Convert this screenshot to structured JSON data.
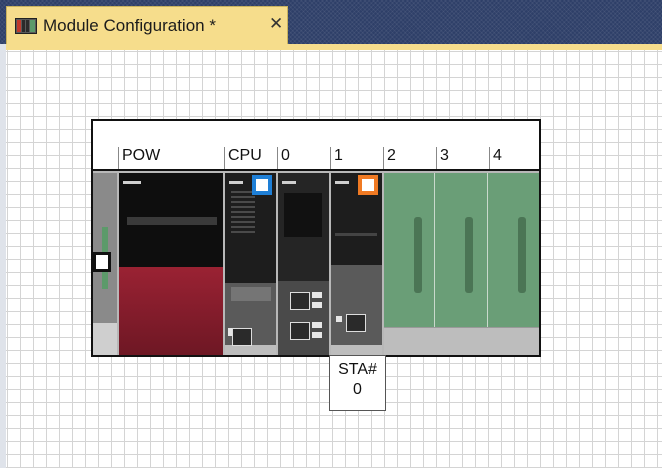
{
  "tab": {
    "title": "Module Configuration *",
    "close_glyph": "✕",
    "icon": "module-configuration-icon"
  },
  "rack": {
    "slot_labels": [
      "POW",
      "CPU",
      "0",
      "1",
      "2",
      "3",
      "4"
    ],
    "modules": [
      {
        "slot": "POW",
        "icon": "power-supply-module"
      },
      {
        "slot": "CPU",
        "icon": "cpu-module",
        "indicator_color": "#1e7fd6"
      },
      {
        "slot": "0",
        "icon": "network-module"
      },
      {
        "slot": "1",
        "icon": "io-module",
        "indicator_color": "#f07a23"
      },
      {
        "slot": "2",
        "icon": "empty-slot"
      },
      {
        "slot": "3",
        "icon": "empty-slot"
      },
      {
        "slot": "4",
        "icon": "empty-slot"
      }
    ]
  },
  "station": {
    "label": "STA#",
    "number": "0"
  },
  "colors": {
    "tab_bg": "#f6dd8c",
    "tabstrip_bg": "#2e3f68",
    "power_module": "#8c1f2e",
    "empty_slot": "#6a9e77",
    "cpu_indicator": "#1e7fd6",
    "module_indicator": "#f07a23"
  }
}
